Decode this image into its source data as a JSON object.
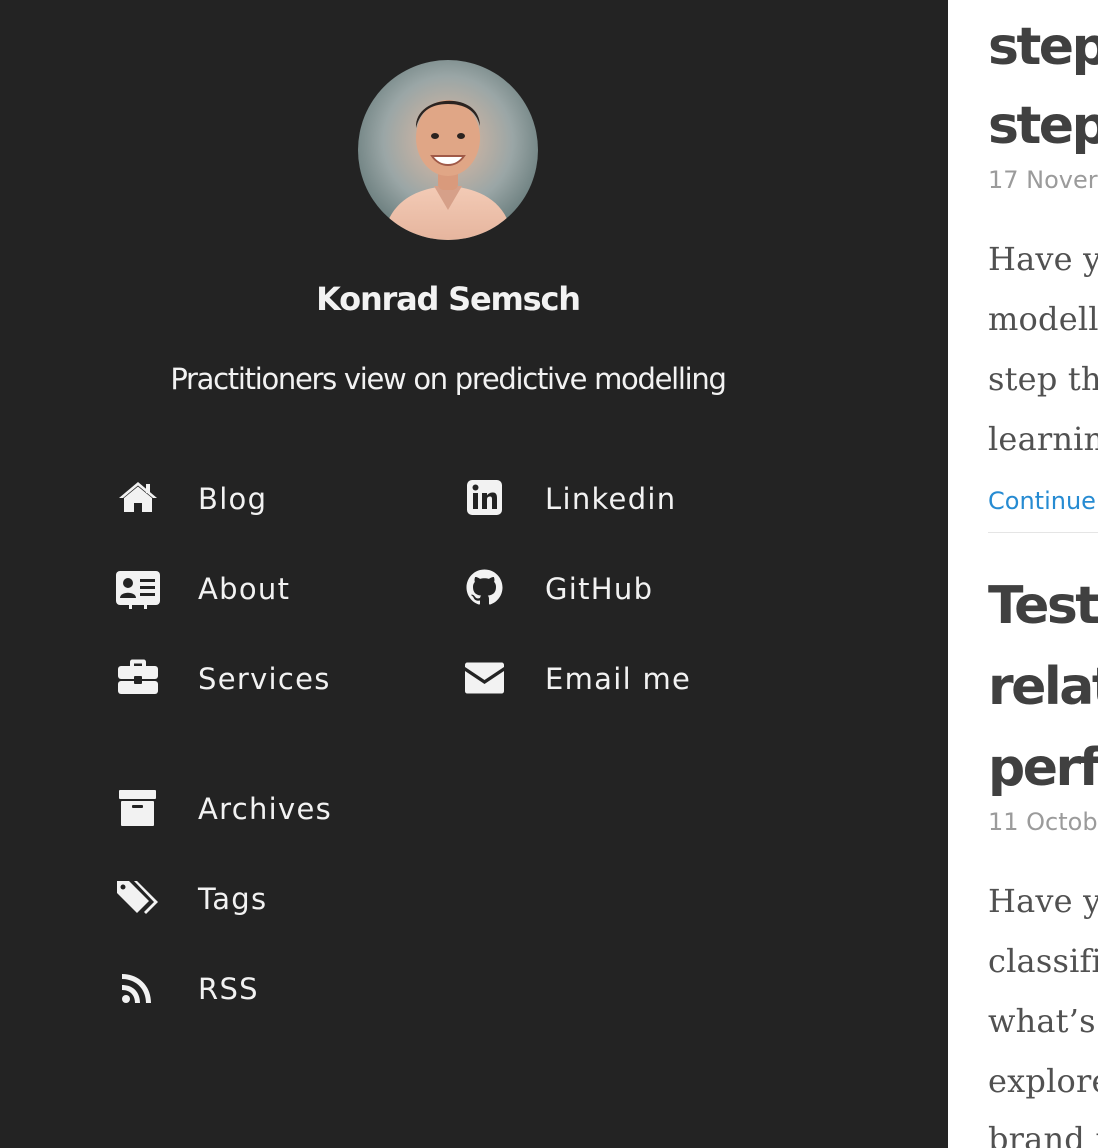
{
  "profile": {
    "name": "Konrad Semsch",
    "tagline": "Practitioners view on predictive modelling"
  },
  "nav": {
    "blog": {
      "label": "Blog",
      "icon": "home-icon"
    },
    "about": {
      "label": "About",
      "icon": "id-card-icon"
    },
    "services": {
      "label": "Services",
      "icon": "briefcase-icon"
    },
    "linkedin": {
      "label": "Linkedin",
      "icon": "linkedin-icon"
    },
    "github": {
      "label": "GitHub",
      "icon": "github-icon"
    },
    "email": {
      "label": "Email me",
      "icon": "envelope-icon"
    },
    "archives": {
      "label": "Archives",
      "icon": "archive-box-icon"
    },
    "tags": {
      "label": "Tags",
      "icon": "tags-icon"
    },
    "rss": {
      "label": "RSS",
      "icon": "rss-icon"
    }
  },
  "posts": [
    {
      "title_lines": [
        "step",
        "step"
      ],
      "date": "17 Nover",
      "excerpt_lines": [
        "Have yo",
        "modelli",
        "step th",
        "learnin"
      ],
      "continue": "Continue"
    },
    {
      "title_lines": [
        "Test",
        "relat",
        "perfo"
      ],
      "date": "11 Octob",
      "excerpt_lines": [
        "Have yo",
        "classific",
        "what’s",
        "explore",
        "brand r"
      ]
    }
  ],
  "colors": {
    "sidebar_bg": "#232323",
    "sidebar_text": "#f2f2f2",
    "title": "#404040",
    "date": "#9b9b9b",
    "body": "#515151",
    "link": "#268bd2"
  }
}
